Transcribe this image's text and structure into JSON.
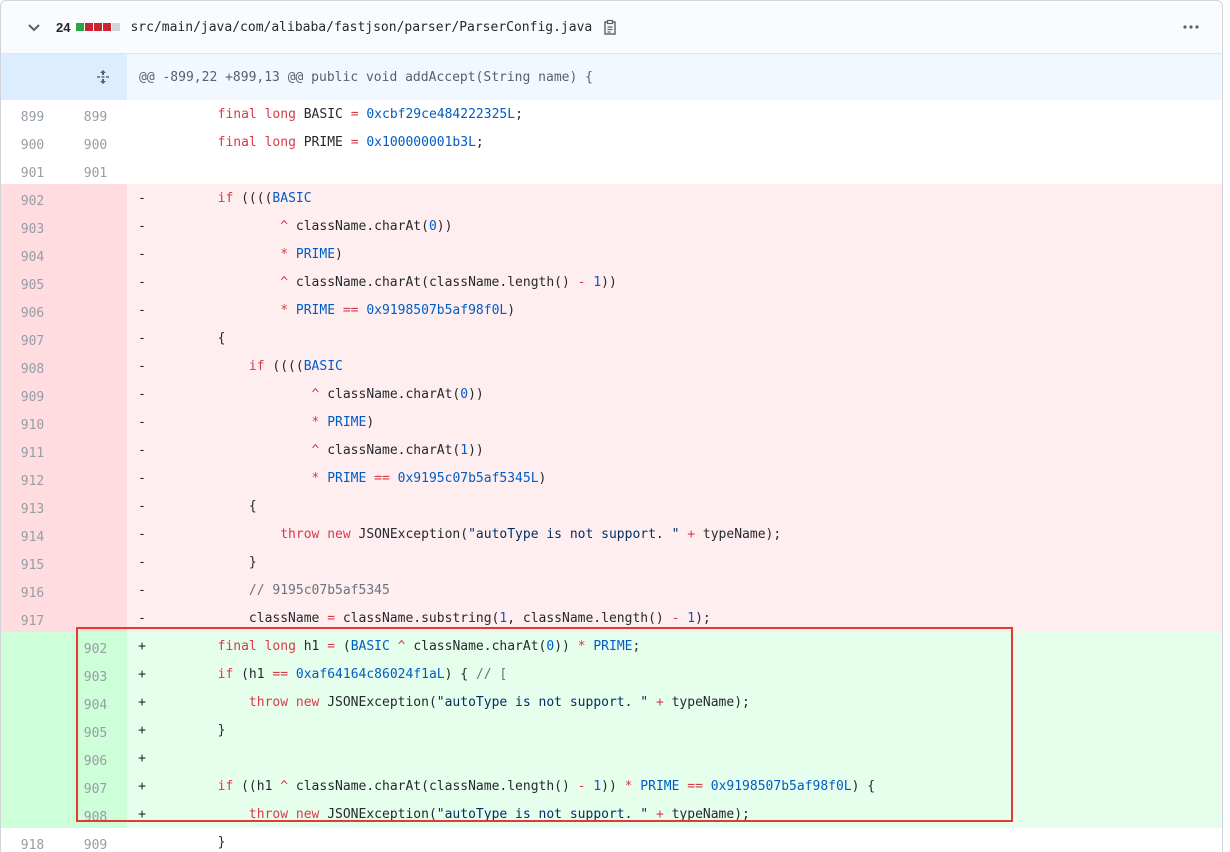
{
  "file": {
    "additions_deletions": "24",
    "path": "src/main/java/com/alibaba/fastjson/parser/ParserConfig.java",
    "diffstat_colors": [
      "#28a745",
      "#cb2431",
      "#cb2431",
      "#cb2431",
      "#d1d5da"
    ]
  },
  "hunk_header": "@@ -899,22 +899,13 @@ public void addAccept(String name) {",
  "icons": {
    "collapse": "chevron-down-icon",
    "copy": "clipboard-icon",
    "expand": "unfold-icon",
    "menu": "kebab-horizontal-icon"
  },
  "lines": [
    {
      "type": "ctx",
      "old": "899",
      "new": "899",
      "sign": "",
      "tokens": [
        [
          "p",
          "        "
        ],
        [
          "k",
          "final long "
        ],
        [
          "p",
          "BASIC "
        ],
        [
          "k",
          "= "
        ],
        [
          "n",
          "0xcbf29ce484222325L"
        ],
        [
          "p",
          ";"
        ]
      ]
    },
    {
      "type": "ctx",
      "old": "900",
      "new": "900",
      "sign": "",
      "tokens": [
        [
          "p",
          "        "
        ],
        [
          "k",
          "final long "
        ],
        [
          "p",
          "PRIME "
        ],
        [
          "k",
          "= "
        ],
        [
          "n",
          "0x100000001b3L"
        ],
        [
          "p",
          ";"
        ]
      ]
    },
    {
      "type": "ctx",
      "old": "901",
      "new": "901",
      "sign": "",
      "tokens": [
        [
          "p",
          ""
        ]
      ]
    },
    {
      "type": "del",
      "old": "902",
      "new": "",
      "sign": "-",
      "tokens": [
        [
          "p",
          "        "
        ],
        [
          "k",
          "if "
        ],
        [
          "p",
          "(((("
        ],
        [
          "n",
          "BASIC"
        ]
      ]
    },
    {
      "type": "del",
      "old": "903",
      "new": "",
      "sign": "-",
      "tokens": [
        [
          "p",
          "                "
        ],
        [
          "k",
          "^ "
        ],
        [
          "p",
          "className.charAt("
        ],
        [
          "n",
          "0"
        ],
        [
          "p",
          "))"
        ]
      ]
    },
    {
      "type": "del",
      "old": "904",
      "new": "",
      "sign": "-",
      "tokens": [
        [
          "p",
          "                "
        ],
        [
          "k",
          "* "
        ],
        [
          "n",
          "PRIME"
        ],
        [
          "p",
          ")"
        ]
      ]
    },
    {
      "type": "del",
      "old": "905",
      "new": "",
      "sign": "-",
      "tokens": [
        [
          "p",
          "                "
        ],
        [
          "k",
          "^ "
        ],
        [
          "p",
          "className.charAt(className.length() "
        ],
        [
          "k",
          "- "
        ],
        [
          "n",
          "1"
        ],
        [
          "p",
          "))"
        ]
      ]
    },
    {
      "type": "del",
      "old": "906",
      "new": "",
      "sign": "-",
      "tokens": [
        [
          "p",
          "                "
        ],
        [
          "k",
          "* "
        ],
        [
          "n",
          "PRIME "
        ],
        [
          "k",
          "== "
        ],
        [
          "n",
          "0x9198507b5af98f0L"
        ],
        [
          "p",
          ")"
        ]
      ]
    },
    {
      "type": "del",
      "old": "907",
      "new": "",
      "sign": "-",
      "tokens": [
        [
          "p",
          "        {"
        ]
      ]
    },
    {
      "type": "del",
      "old": "908",
      "new": "",
      "sign": "-",
      "tokens": [
        [
          "p",
          "            "
        ],
        [
          "k",
          "if "
        ],
        [
          "p",
          "(((("
        ],
        [
          "n",
          "BASIC"
        ]
      ]
    },
    {
      "type": "del",
      "old": "909",
      "new": "",
      "sign": "-",
      "tokens": [
        [
          "p",
          "                    "
        ],
        [
          "k",
          "^ "
        ],
        [
          "p",
          "className.charAt("
        ],
        [
          "n",
          "0"
        ],
        [
          "p",
          "))"
        ]
      ]
    },
    {
      "type": "del",
      "old": "910",
      "new": "",
      "sign": "-",
      "tokens": [
        [
          "p",
          "                    "
        ],
        [
          "k",
          "* "
        ],
        [
          "n",
          "PRIME"
        ],
        [
          "p",
          ")"
        ]
      ]
    },
    {
      "type": "del",
      "old": "911",
      "new": "",
      "sign": "-",
      "tokens": [
        [
          "p",
          "                    "
        ],
        [
          "k",
          "^ "
        ],
        [
          "p",
          "className.charAt("
        ],
        [
          "n",
          "1"
        ],
        [
          "p",
          "))"
        ]
      ]
    },
    {
      "type": "del",
      "old": "912",
      "new": "",
      "sign": "-",
      "tokens": [
        [
          "p",
          "                    "
        ],
        [
          "k",
          "* "
        ],
        [
          "n",
          "PRIME "
        ],
        [
          "k",
          "== "
        ],
        [
          "n",
          "0x9195c07b5af5345L"
        ],
        [
          "p",
          ")"
        ]
      ]
    },
    {
      "type": "del",
      "old": "913",
      "new": "",
      "sign": "-",
      "tokens": [
        [
          "p",
          "            {"
        ]
      ]
    },
    {
      "type": "del",
      "old": "914",
      "new": "",
      "sign": "-",
      "tokens": [
        [
          "p",
          "                "
        ],
        [
          "k",
          "throw new "
        ],
        [
          "p",
          "JSONException("
        ],
        [
          "s",
          "\"autoType is not support. \""
        ],
        [
          "p",
          " "
        ],
        [
          "k",
          "+ "
        ],
        [
          "p",
          "typeName);"
        ]
      ]
    },
    {
      "type": "del",
      "old": "915",
      "new": "",
      "sign": "-",
      "tokens": [
        [
          "p",
          "            }"
        ]
      ]
    },
    {
      "type": "del",
      "old": "916",
      "new": "",
      "sign": "-",
      "tokens": [
        [
          "p",
          "            "
        ],
        [
          "c",
          "// 9195c07b5af5345"
        ]
      ]
    },
    {
      "type": "del",
      "old": "917",
      "new": "",
      "sign": "-",
      "tokens": [
        [
          "p",
          "            className "
        ],
        [
          "k",
          "= "
        ],
        [
          "p",
          "className.substring("
        ],
        [
          "n",
          "1"
        ],
        [
          "p",
          ", className.length() "
        ],
        [
          "k",
          "- "
        ],
        [
          "n",
          "1"
        ],
        [
          "p",
          ");"
        ]
      ]
    },
    {
      "type": "add",
      "old": "",
      "new": "902",
      "sign": "+",
      "tokens": [
        [
          "p",
          "        "
        ],
        [
          "k",
          "final long "
        ],
        [
          "p",
          "h1 "
        ],
        [
          "k",
          "= "
        ],
        [
          "p",
          "("
        ],
        [
          "n",
          "BASIC "
        ],
        [
          "k",
          "^ "
        ],
        [
          "p",
          "className.charAt("
        ],
        [
          "n",
          "0"
        ],
        [
          "p",
          ")) "
        ],
        [
          "k",
          "* "
        ],
        [
          "n",
          "PRIME"
        ],
        [
          "p",
          ";"
        ]
      ]
    },
    {
      "type": "add",
      "old": "",
      "new": "903",
      "sign": "+",
      "tokens": [
        [
          "p",
          "        "
        ],
        [
          "k",
          "if "
        ],
        [
          "p",
          "(h1 "
        ],
        [
          "k",
          "== "
        ],
        [
          "n",
          "0xaf64164c86024f1aL"
        ],
        [
          "p",
          ") { "
        ],
        [
          "c",
          "// ["
        ]
      ]
    },
    {
      "type": "add",
      "old": "",
      "new": "904",
      "sign": "+",
      "tokens": [
        [
          "p",
          "            "
        ],
        [
          "k",
          "throw new "
        ],
        [
          "p",
          "JSONException("
        ],
        [
          "s",
          "\"autoType is not support. \""
        ],
        [
          "p",
          " "
        ],
        [
          "k",
          "+ "
        ],
        [
          "p",
          "typeName);"
        ]
      ]
    },
    {
      "type": "add",
      "old": "",
      "new": "905",
      "sign": "+",
      "tokens": [
        [
          "p",
          "        }"
        ]
      ]
    },
    {
      "type": "add",
      "old": "",
      "new": "906",
      "sign": "+",
      "tokens": [
        [
          "p",
          ""
        ]
      ]
    },
    {
      "type": "add",
      "old": "",
      "new": "907",
      "sign": "+",
      "tokens": [
        [
          "p",
          "        "
        ],
        [
          "k",
          "if "
        ],
        [
          "p",
          "((h1 "
        ],
        [
          "k",
          "^ "
        ],
        [
          "p",
          "className.charAt(className.length() "
        ],
        [
          "k",
          "- "
        ],
        [
          "n",
          "1"
        ],
        [
          "p",
          ")) "
        ],
        [
          "k",
          "* "
        ],
        [
          "n",
          "PRIME "
        ],
        [
          "k",
          "== "
        ],
        [
          "n",
          "0x9198507b5af98f0L"
        ],
        [
          "p",
          ") {"
        ]
      ]
    },
    {
      "type": "add",
      "old": "",
      "new": "908",
      "sign": "+",
      "tokens": [
        [
          "p",
          "            "
        ],
        [
          "k",
          "throw new "
        ],
        [
          "p",
          "JSONException("
        ],
        [
          "s",
          "\"autoType is not support. \""
        ],
        [
          "p",
          " "
        ],
        [
          "k",
          "+ "
        ],
        [
          "p",
          "typeName);"
        ]
      ]
    },
    {
      "type": "ctx",
      "old": "918",
      "new": "909",
      "sign": "",
      "tokens": [
        [
          "p",
          "        }"
        ]
      ]
    }
  ]
}
